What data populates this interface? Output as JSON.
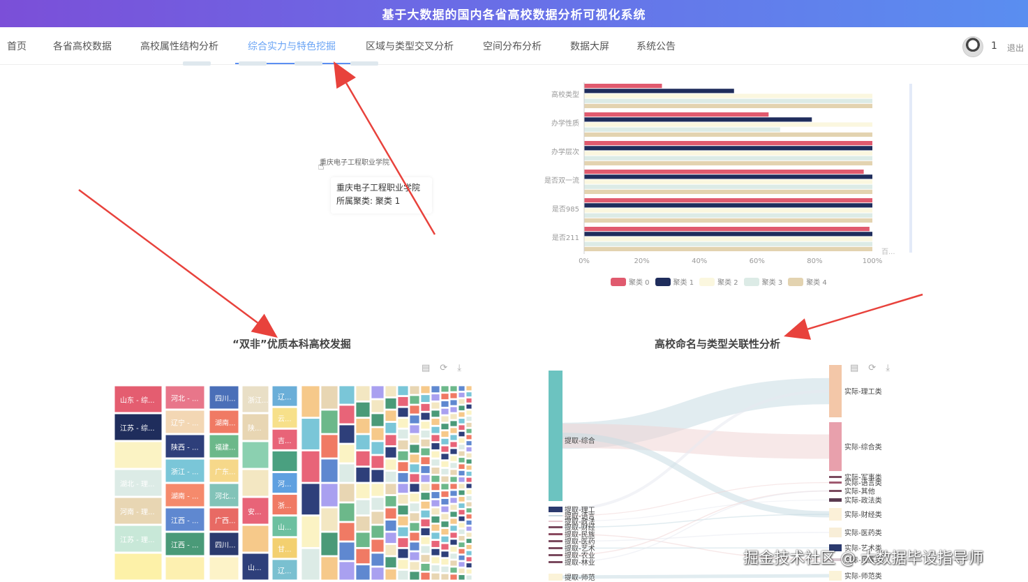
{
  "app": {
    "title": "基于大数据的国内各省高校数据分析可视化系统"
  },
  "nav": {
    "items": [
      {
        "label": "首页"
      },
      {
        "label": "各省高校数据"
      },
      {
        "label": "高校属性结构分析"
      },
      {
        "label": "综合实力与特色挖掘",
        "active": true
      },
      {
        "label": "区域与类型交叉分析"
      },
      {
        "label": "空间分布分析"
      },
      {
        "label": "数据大屏"
      },
      {
        "label": "系统公告"
      }
    ],
    "user_count": "1",
    "logout": "退出"
  },
  "scatter_panel": {
    "hover_label": "重庆电子工程职业学院",
    "tooltip_line1": "重庆电子工程职业学院",
    "tooltip_line2": "所属聚类: 聚类 1"
  },
  "bar_panel": {
    "chart_data": {
      "type": "bar",
      "orientation": "horizontal",
      "stacked": false,
      "categories": [
        "高校类型",
        "办学性质",
        "办学层次",
        "是否双一流",
        "是否985",
        "是否211"
      ],
      "xlim": [
        0,
        100
      ],
      "x_ticks": [
        "0%",
        "20%",
        "40%",
        "60%",
        "80%",
        "100%"
      ],
      "series": [
        {
          "name": "聚类 0",
          "color": "#e05a6e",
          "values": [
            27,
            64,
            100,
            97,
            100,
            99
          ]
        },
        {
          "name": "聚类 1",
          "color": "#1f2d5c",
          "values": [
            52,
            79,
            100,
            100,
            100,
            100
          ]
        },
        {
          "name": "聚类 2",
          "color": "#fbf7df",
          "values": [
            100,
            100,
            100,
            100,
            100,
            100
          ]
        },
        {
          "name": "聚类 3",
          "color": "#dcebe6",
          "values": [
            100,
            68,
            100,
            100,
            100,
            100
          ]
        },
        {
          "name": "聚类 4",
          "color": "#e3d3b0",
          "values": [
            100,
            100,
            100,
            100,
            100,
            100
          ]
        }
      ],
      "grid": false,
      "legend_position": "bottom"
    },
    "corner_label": "百..."
  },
  "treemap_panel": {
    "title": "“双非”优质本科高校发掘",
    "tiles": [
      {
        "label": "山东 - 综...",
        "color": "#e45d70"
      },
      {
        "label": "江苏 - 综...",
        "color": "#1f2d5c"
      },
      {
        "label": "",
        "color": "#fbf3c4"
      },
      {
        "label": "湖北 - 理...",
        "color": "#dcebe6"
      },
      {
        "label": "河南 - 理...",
        "color": "#e8d6b3"
      },
      {
        "label": "江苏 - 理...",
        "color": "#c8e8d8"
      },
      {
        "label": "",
        "color": "#fdf1a8"
      },
      {
        "label": "河北 - ...",
        "color": "#e8768a"
      },
      {
        "label": "辽宁 - ...",
        "color": "#f3d7b4"
      },
      {
        "label": "陕西 - ...",
        "color": "#2e3f7a"
      },
      {
        "label": "浙江 - ...",
        "color": "#7ac6d8"
      },
      {
        "label": "湖南 - ...",
        "color": "#f58a6c"
      },
      {
        "label": "江西 - ...",
        "color": "#5f88d0"
      },
      {
        "label": "江西 - ...",
        "color": "#4a9a78"
      },
      {
        "label": "",
        "color": "#fdf0b0"
      },
      {
        "label": "四川...",
        "color": "#4a6fb8"
      },
      {
        "label": "湖南...",
        "color": "#f07a64"
      },
      {
        "label": "福建...",
        "color": "#6cb88a"
      },
      {
        "label": "广东...",
        "color": "#f6d88a"
      },
      {
        "label": "河北...",
        "color": "#82c3b8"
      },
      {
        "label": "广西...",
        "color": "#e86a64"
      },
      {
        "label": "四川...",
        "color": "#2b3a6e"
      },
      {
        "label": "",
        "color": "#fdf3c8"
      },
      {
        "label": "浙江...",
        "color": "#e9dfc6"
      },
      {
        "label": "陕...",
        "color": "#e8d6b3"
      },
      {
        "label": "",
        "color": "#8bd0b0"
      },
      {
        "label": "",
        "color": "#f3e7c2"
      },
      {
        "label": "安...",
        "color": "#e86478"
      },
      {
        "label": "",
        "color": "#f6c98a"
      },
      {
        "label": "山...",
        "color": "#2e3f7a"
      },
      {
        "label": "辽...",
        "color": "#6aaed8"
      },
      {
        "label": "云...",
        "color": "#f7e08a"
      },
      {
        "label": "吉...",
        "color": "#e86478"
      },
      {
        "label": "",
        "color": "#4aa080"
      },
      {
        "label": "河...",
        "color": "#5fa0e0"
      },
      {
        "label": "浙...",
        "color": "#f07a64"
      },
      {
        "label": "山...",
        "color": "#6cc0a0"
      },
      {
        "label": "甘...",
        "color": "#f3d070"
      },
      {
        "label": "辽...",
        "color": "#7ac0d0"
      }
    ],
    "small_tile_colors": [
      "#f6c98a",
      "#7ac6d8",
      "#e86478",
      "#2e3f7a",
      "#fbf3c4",
      "#dcebe6",
      "#e8d6b3",
      "#6cb88a",
      "#f07a64",
      "#5f88d0",
      "#a9a0f0",
      "#f3e7c2",
      "#4a9a78"
    ]
  },
  "sankey_panel": {
    "title": "高校命名与类型关联性分析",
    "left_nodes": [
      {
        "label": "提取-综合",
        "color": "#6cc3c0"
      },
      {
        "label": "提取-理工",
        "color": "#2b3a6e"
      },
      {
        "label": "提取-语言",
        "color": "#c8d8e0"
      },
      {
        "label": "提取-政法",
        "color": "#e8c8d0"
      },
      {
        "label": "提取-财经",
        "color": "#7a4a5e"
      },
      {
        "label": "提取-民族",
        "color": "#8a4a60"
      },
      {
        "label": "提取-医药",
        "color": "#7a4a5e"
      },
      {
        "label": "提取-艺术",
        "color": "#7a4a5e"
      },
      {
        "label": "提取-农业",
        "color": "#7a4a5e"
      },
      {
        "label": "提取-林业",
        "color": "#7a4a5e"
      },
      {
        "label": "提取-师范",
        "color": "#fbf3d8"
      }
    ],
    "right_nodes": [
      {
        "label": "实际-理工类",
        "color": "#f3c7a8"
      },
      {
        "label": "实际-综合类",
        "color": "#e8a0ac"
      },
      {
        "label": "实际-军事类",
        "color": "#7a4a5e"
      },
      {
        "label": "实际-语言类",
        "color": "#a05a70"
      },
      {
        "label": "实际-其他",
        "color": "#7a4a5e"
      },
      {
        "label": "实际-政法类",
        "color": "#5a3a50"
      },
      {
        "label": "实际-财经类",
        "color": "#fbf0d8"
      },
      {
        "label": "实际-医药类",
        "color": "#f8eed8"
      },
      {
        "label": "实际-艺术类",
        "color": "#2b3a6e"
      },
      {
        "label": "实际-民族类",
        "color": "#d8c8d0"
      },
      {
        "label": "实际-师范类",
        "color": "#fbf3d8"
      }
    ]
  },
  "toolbox": {
    "icons": [
      "data-view-icon",
      "refresh-icon",
      "download-icon"
    ]
  },
  "watermark": "掘金技术社区 @ 大数据毕设指导师",
  "annotation_color": "#e8423c"
}
